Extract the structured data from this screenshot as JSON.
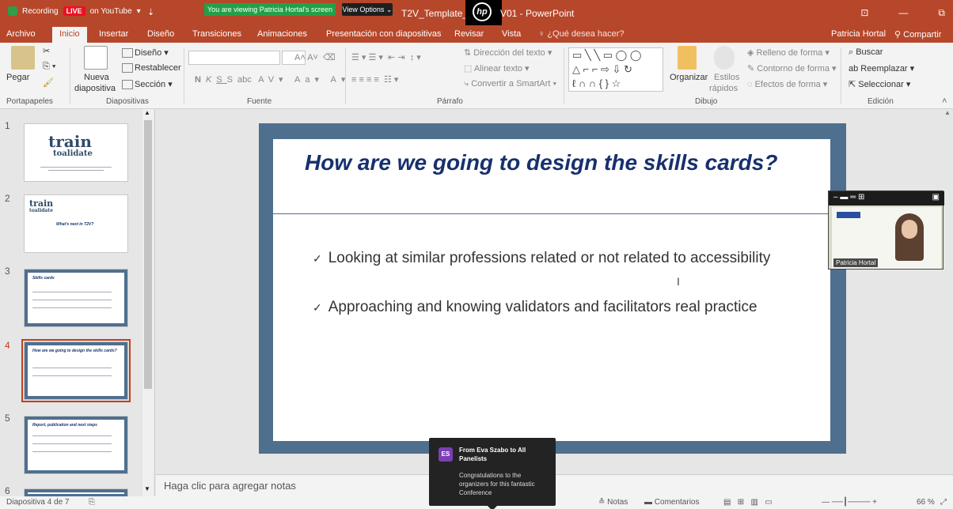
{
  "zoom": {
    "recording_label": "Recording",
    "live_label": "LIVE",
    "youtube_label": "on YouTube",
    "viewing_banner": "You are viewing Patricia Hortal's screen",
    "view_options": "View Options"
  },
  "window": {
    "title_left": "T2V_Template_PP",
    "title_right": "V01 - PowerPoint",
    "hp_logo": "hp"
  },
  "tabs": [
    "Archivo",
    "Inicio",
    "Insertar",
    "Diseño",
    "Transiciones",
    "Animaciones",
    "Presentación con diapositivas",
    "Revisar",
    "Vista"
  ],
  "active_tab": "Inicio",
  "tell_me": "¿Qué desea hacer?",
  "user": {
    "name": "Patricia Hortal",
    "share": "Compartir"
  },
  "ribbon": {
    "portapapeles": {
      "label": "Portapapeles",
      "paste": "Pegar"
    },
    "diapositivas": {
      "label": "Diapositivas",
      "new_slide_1": "Nueva",
      "new_slide_2": "diapositiva",
      "layout": "Diseño",
      "reset": "Restablecer",
      "section": "Sección"
    },
    "fuente": {
      "label": "Fuente",
      "bold": "N",
      "italic": "K",
      "underline": "S",
      "shadow": "S",
      "strike": "abc",
      "spacing": "AV",
      "case": "Aa",
      "color": "A"
    },
    "parrafo": {
      "label": "Párrafo",
      "direction": "Dirección del texto",
      "align": "Alinear texto",
      "smartart": "Convertir a SmartArt"
    },
    "dibujo": {
      "label": "Dibujo",
      "arrange": "Organizar",
      "styles_1": "Estilos",
      "styles_2": "rápidos",
      "fill": "Relleno de forma",
      "outline": "Contorno de forma",
      "effects": "Efectos de forma"
    },
    "edicion": {
      "label": "Edición",
      "find": "Buscar",
      "replace": "Reemplazar",
      "select": "Seleccionar"
    }
  },
  "thumbnails": [
    {
      "num": "1",
      "logo_top": "train",
      "logo_bottom": "toalidate"
    },
    {
      "num": "2",
      "logo_top": "train",
      "logo_bottom": "toalidate",
      "title": "What's next in T2V?"
    },
    {
      "num": "3",
      "title": "Skills cards"
    },
    {
      "num": "4",
      "title": "How are we going to design the skills cards?"
    },
    {
      "num": "5",
      "title": "Report, publication and next steps"
    },
    {
      "num": "6"
    }
  ],
  "slide": {
    "title": "How are we going to design the skills cards?",
    "bullets": [
      "Looking at similar professions related or not related to accessibility",
      "Approaching and knowing validators and facilitators real practice"
    ]
  },
  "video": {
    "name": "Patricia Hortal"
  },
  "notes_placeholder": "Haga clic para agregar notas",
  "status": {
    "slide_info": "Diapositiva 4 de 7",
    "notes": "Notas",
    "comments": "Comentarios",
    "zoom": "66 %"
  },
  "chat": {
    "initials": "ES",
    "from": "From Eva Szabo to All Panelists",
    "message": "Congratulations to the organizers for this fantastic Conference"
  },
  "colors": {
    "accent": "#b7472a",
    "slide_border": "#4f6f8f",
    "title_blue": "#17306d"
  }
}
